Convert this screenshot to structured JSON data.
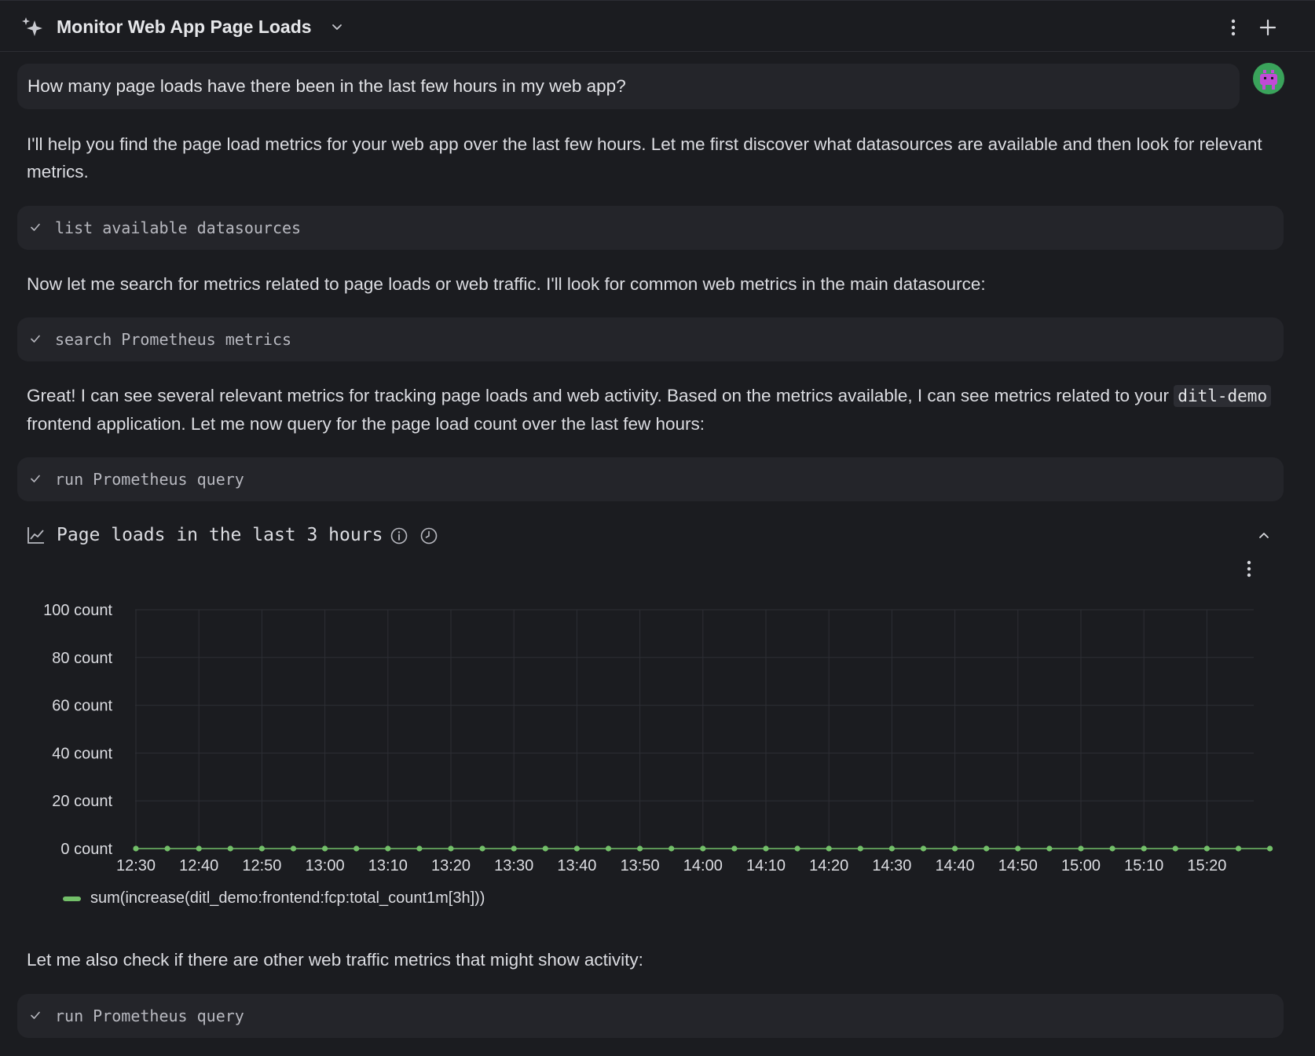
{
  "header": {
    "title": "Monitor Web App Page Loads",
    "title_icon": "sparkle-icon",
    "dropdown_icon": "chevron-down-icon",
    "menu_icon": "kebab-icon",
    "new_icon": "plus-icon"
  },
  "conversation": {
    "user_message": "How many page loads have there been in the last few hours in my web app?",
    "assistant_intro": "I'll help you find the page load metrics for your web app over the last few hours. Let me first discover what datasources are available and then look for relevant metrics.",
    "tool_1": "list available datasources",
    "assistant_2": "Now let me search for metrics related to page loads or web traffic. I'll look for common web metrics in the main datasource:",
    "tool_2": "search Prometheus metrics",
    "assistant_3_part1": "Great! I can see several relevant metrics for tracking page loads and web activity. Based on the metrics available, I can see metrics related to your",
    "assistant_3_code": "ditl-demo",
    "assistant_3_part2": "frontend application. Let me now query for the page load count over the last few hours:",
    "tool_3": "run Prometheus query",
    "assistant_4": "Let me also check if there are other web traffic metrics that might show activity:",
    "tool_4": "run Prometheus query"
  },
  "panel": {
    "title": "Page loads in the last 3 hours",
    "icons": [
      "graph-icon",
      "info-icon",
      "clock-icon",
      "chevron-up-icon",
      "kebab-icon"
    ]
  },
  "chart_data": {
    "type": "line",
    "title": "Page loads in the last 3 hours",
    "y_ticks": [
      "0 count",
      "20 count",
      "40 count",
      "60 count",
      "80 count",
      "100 count"
    ],
    "ylim": [
      0,
      100
    ],
    "x_ticks": [
      "12:30",
      "12:40",
      "12:50",
      "13:00",
      "13:10",
      "13:20",
      "13:30",
      "13:40",
      "13:50",
      "14:00",
      "14:10",
      "14:20",
      "14:30",
      "14:40",
      "14:50",
      "15:00",
      "15:10",
      "15:20"
    ],
    "x_start": "12:30",
    "x_step_minutes": 5,
    "grid": true,
    "legend_position": "bottom-left",
    "series": [
      {
        "name": "sum(increase(ditl_demo:frontend:fcp:total_count1m[3h]))",
        "color": "#73bf69",
        "values": [
          0,
          0,
          0,
          0,
          0,
          0,
          0,
          0,
          0,
          0,
          0,
          0,
          0,
          0,
          0,
          0,
          0,
          0,
          0,
          0,
          0,
          0,
          0,
          0,
          0,
          0,
          0,
          0,
          0,
          0,
          0,
          0,
          0,
          0,
          0,
          0,
          0
        ]
      }
    ]
  }
}
